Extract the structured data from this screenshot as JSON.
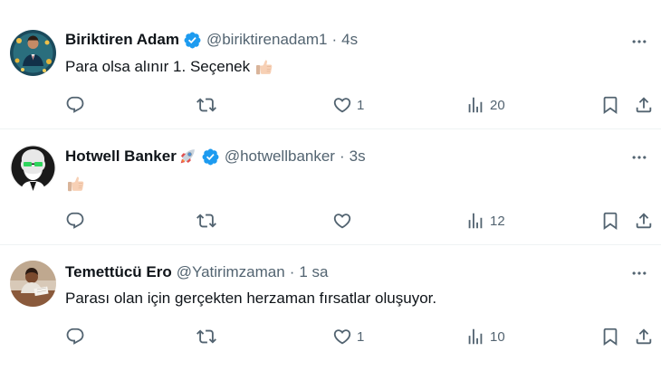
{
  "tweets": [
    {
      "name": "Biriktiren Adam",
      "handle": "@biriktirenadam1",
      "separator": "·",
      "time": "4s",
      "text": "Para olsa alınır 1. Seçenek",
      "thumb_emoji": "thumbs-up-light-skin",
      "verified": true,
      "name_emoji": "",
      "counts": {
        "replies": "",
        "retweets": "",
        "likes": "1",
        "views": "20"
      }
    },
    {
      "name": "Hotwell Banker",
      "handle": "@hotwellbanker",
      "separator": "·",
      "time": "3s",
      "text": "",
      "thumb_emoji": "thumbs-up-light-skin",
      "verified": true,
      "name_emoji": "rocket",
      "counts": {
        "replies": "",
        "retweets": "",
        "likes": "",
        "views": "12"
      }
    },
    {
      "name": "Temettücü Ero",
      "handle": "@Yatirimzaman",
      "separator": "·",
      "time": "1 sa",
      "text": "Parası olan için gerçekten herzaman fırsatlar oluşuyor.",
      "thumb_emoji": "",
      "verified": false,
      "name_emoji": "",
      "counts": {
        "replies": "",
        "retweets": "",
        "likes": "1",
        "views": "10"
      }
    }
  ],
  "icons": {
    "reply": "reply-icon",
    "retweet": "retweet-icon",
    "like": "heart-icon",
    "views": "views-icon",
    "bookmark": "bookmark-icon",
    "share": "share-icon",
    "more": "more-icon",
    "verified": "verified-badge-icon"
  },
  "colors": {
    "text": "#0f1419",
    "secondary": "#536471",
    "verified": "#1d9bf0",
    "divider": "#eff3f4"
  }
}
